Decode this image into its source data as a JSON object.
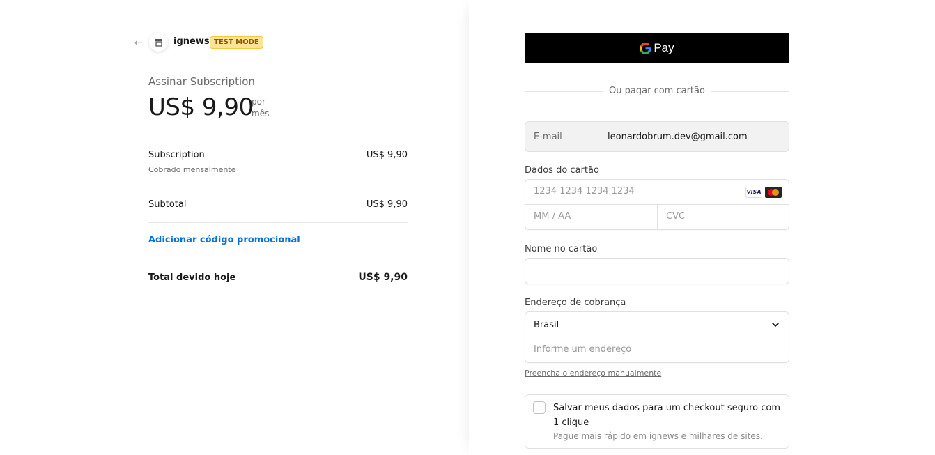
{
  "header": {
    "back_icon": "arrow-left-icon",
    "store_icon": "store-icon",
    "brand": "ignews",
    "badge": "TEST MODE"
  },
  "summary": {
    "plan_title": "Assinar Subscription",
    "price": "US$ 9,90",
    "per_line1": "por",
    "per_line2": "mês",
    "items": [
      {
        "label": "Subscription",
        "sublabel": "Cobrado mensalmente",
        "value": "US$ 9,90"
      }
    ],
    "subtotal_label": "Subtotal",
    "subtotal_value": "US$ 9,90",
    "promo_label": "Adicionar código promocional",
    "total_label": "Total devido hoje",
    "total_value": "US$ 9,90"
  },
  "payment": {
    "gpay_label": "Pay",
    "divider_text": "Ou pagar com cartão",
    "email_label": "E-mail",
    "email_value": "leonardobrum.dev@gmail.com",
    "card_label": "Dados do cartão",
    "card_number_placeholder": "1234 1234 1234 1234",
    "card_brand_visa": "VISA",
    "expiry_placeholder": "MM / AA",
    "cvc_placeholder": "CVC",
    "name_label": "Nome no cartão",
    "name_value": "",
    "address_label": "Endereço de cobrança",
    "country_value": "Brasil",
    "address_placeholder": "Informe um endereço",
    "manual_link": "Preencha o endereço manualmente",
    "save_title": "Salvar meus dados para um checkout seguro com 1 clique",
    "save_subtitle": "Pague mais rápido em ignews e milhares de sites.",
    "save_checked": false
  },
  "colors": {
    "accent": "#0570de",
    "badge_bg": "#fde39a",
    "gpay_bg": "#000000"
  }
}
